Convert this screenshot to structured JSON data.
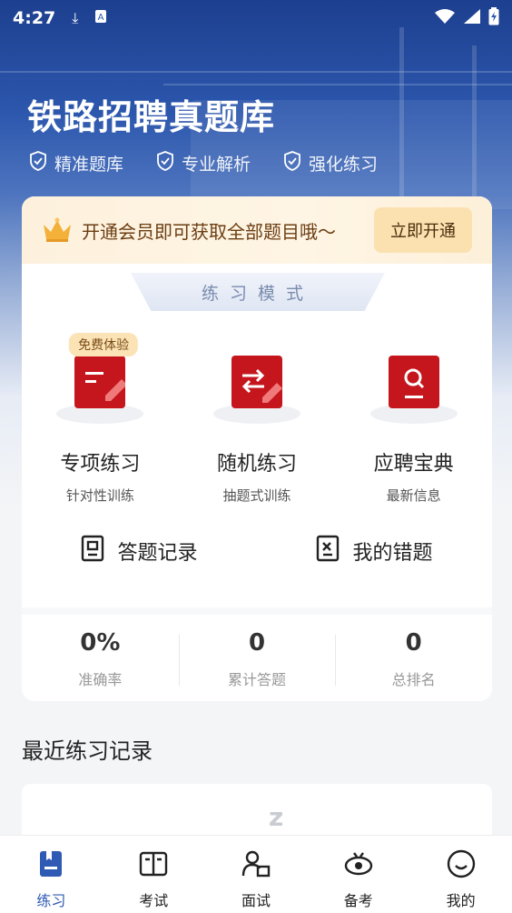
{
  "status_bar": {
    "time": "4:27",
    "download_icon": "download-icon",
    "app_icon": "app-notification-icon"
  },
  "header": {
    "title": "铁路招聘真题库",
    "features": [
      "精准题库",
      "专业解析",
      "强化练习"
    ]
  },
  "vip": {
    "text": "开通会员即可获取全部题目哦～",
    "button": "立即开通"
  },
  "practice_mode": {
    "tab_title": "练习模式",
    "modes": [
      {
        "title": "专项练习",
        "subtitle": "针对性训练",
        "badge": "免费体验",
        "icon": "document-edit-icon"
      },
      {
        "title": "随机练习",
        "subtitle": "抽题式训练",
        "icon": "shuffle-edit-icon"
      },
      {
        "title": "应聘宝典",
        "subtitle": "最新信息",
        "icon": "book-search-icon"
      }
    ]
  },
  "records": [
    {
      "label": "答题记录",
      "icon": "answer-record-icon"
    },
    {
      "label": "我的错题",
      "icon": "wrong-questions-icon"
    }
  ],
  "stats": [
    {
      "value": "0%",
      "label": "准确率"
    },
    {
      "value": "0",
      "label": "累计答题"
    },
    {
      "value": "0",
      "label": "总排名"
    }
  ],
  "recent": {
    "title": "最近练习记录",
    "empty_mark": "z"
  },
  "bottom_nav": [
    {
      "label": "练习",
      "icon": "practice-icon",
      "active": true
    },
    {
      "label": "考试",
      "icon": "exam-icon",
      "active": false
    },
    {
      "label": "面试",
      "icon": "interview-icon",
      "active": false
    },
    {
      "label": "备考",
      "icon": "prepare-icon",
      "active": false
    },
    {
      "label": "我的",
      "icon": "profile-icon",
      "active": false
    }
  ],
  "colors": {
    "primary": "#2f5bb5",
    "brand_red": "#c4161c",
    "vip_text": "#6b3d12"
  }
}
